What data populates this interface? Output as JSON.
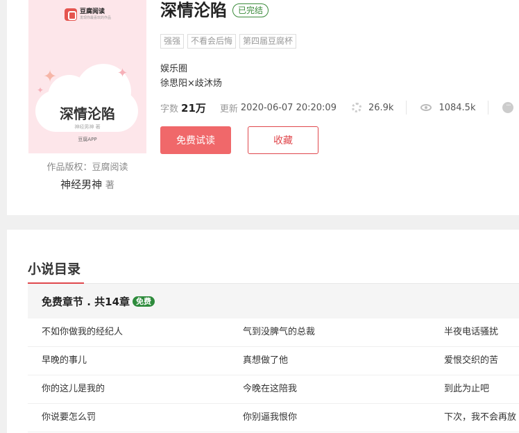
{
  "cover": {
    "logo_name": "豆腐阅读",
    "logo_sub": "发现你最喜欢的作品",
    "title": "深情沦陷",
    "author": "神经男神 著",
    "app": "豆腐APP"
  },
  "copyright": "作品版权：豆腐阅读",
  "author": {
    "name": "神经男神",
    "suffix": "著"
  },
  "book": {
    "title": "深情沦陷",
    "status": "已完结",
    "tags": [
      "强强",
      "不看会后悔",
      "第四届豆腐杯"
    ],
    "genre": "娱乐圈",
    "cp": "徐思阳×歧沐炀"
  },
  "stats": {
    "words_label": "字数",
    "words_value": "21万",
    "updated_label": "更新",
    "updated_value": "2020-06-07 20:20:09",
    "likes": "26.9k",
    "views": "1084.5k",
    "more_icon": "ellipsis-circle-icon"
  },
  "actions": {
    "read_label": "免费试读",
    "favorite_label": "收藏"
  },
  "catalog": {
    "title": "小说目录",
    "free_section": "免费章节 . 共14章",
    "free_badge": "免费",
    "rows": [
      [
        "不如你做我的经纪人",
        "气到没脾气的总裁",
        "半夜电话骚扰"
      ],
      [
        "早晚的事儿",
        "真想做了他",
        "爱恨交织的苦"
      ],
      [
        "你的这儿是我的",
        "今晚在这陪我",
        "到此为止吧"
      ],
      [
        "你说要怎么罚",
        "你别逼我恨你",
        "下次，我不会再放"
      ]
    ]
  },
  "colors": {
    "accent": "#e0474c",
    "read_button": "#f0686a",
    "complete_green": "#3a8a3a",
    "free_badge": "#2e8b3c",
    "cover_bg": "#fde6ea"
  }
}
